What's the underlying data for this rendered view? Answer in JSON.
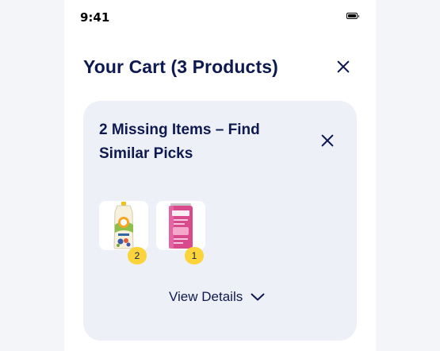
{
  "status_bar": {
    "time": "9:41"
  },
  "header": {
    "title": "Your Cart (3 Products)"
  },
  "missing_card": {
    "title": "2 Missing Items – Find Similar Picks",
    "products": [
      {
        "name": "food-pouch",
        "quantity": "2"
      },
      {
        "name": "poppi-soda-can",
        "quantity": "1"
      }
    ],
    "view_details_label": "View Details"
  },
  "colors": {
    "navy": "#0e1a4f",
    "card_bg": "#eef0f7",
    "badge": "#fbd33a",
    "page_bg": "#f4f5f8"
  }
}
